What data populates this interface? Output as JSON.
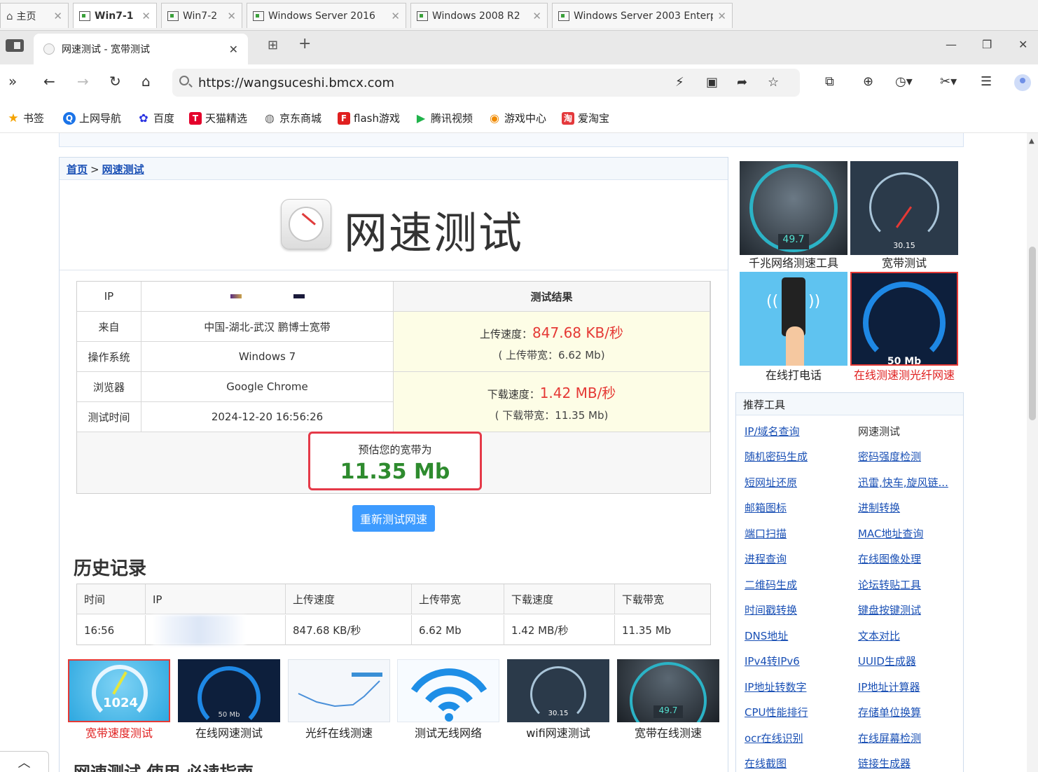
{
  "vm_tabs": [
    {
      "label": "主页",
      "active": false
    },
    {
      "label": "Win7-1",
      "active": true
    },
    {
      "label": "Win7-2",
      "active": false
    },
    {
      "label": "Windows Server 2016",
      "active": false
    },
    {
      "label": "Windows 2008 R2",
      "active": false
    },
    {
      "label": "Windows Server 2003 Enterpr...",
      "active": false
    }
  ],
  "browser": {
    "tab_title": "网速测试 - 宽带测试",
    "url": "https://wangsuceshi.bmcx.com"
  },
  "bookmarks": [
    {
      "label": "书签",
      "color": "#f5a300"
    },
    {
      "label": "上网导航",
      "color": "#1a73e8"
    },
    {
      "label": "百度",
      "color": "#2932e1"
    },
    {
      "label": "天猫精选",
      "color": "#e4002b"
    },
    {
      "label": "京东商城",
      "color": "#666666"
    },
    {
      "label": "flash游戏",
      "color": "#e02020"
    },
    {
      "label": "腾讯视频",
      "color": "#20b34b"
    },
    {
      "label": "游戏中心",
      "color": "#f08a00"
    },
    {
      "label": "爱淘宝",
      "color": "#e4393c"
    }
  ],
  "breadcrumb": {
    "home": "首页",
    "sep": ">",
    "current": "网速测试"
  },
  "hero_title": "网速测试",
  "result": {
    "ip_label": "IP",
    "from_label": "来自",
    "from_value": "中国-湖北-武汉 鹏博士宽带",
    "os_label": "操作系统",
    "os_value": "Windows 7",
    "browser_label": "浏览器",
    "browser_value": "Google Chrome",
    "time_label": "测试时间",
    "time_value": "2024-12-20 16:56:26",
    "result_header": "测试结果",
    "upload_label": "上传速度：",
    "upload_value": "847.68 KB/秒",
    "upload_bw": "( 上传带宽：6.62 Mb)",
    "download_label": "下载速度：",
    "download_value": "1.42 MB/秒",
    "download_bw": "( 下载带宽：11.35 Mb)",
    "estimate_label": "预估您的宽带为",
    "estimate_value": "11.35 Mb"
  },
  "retest_label": "重新测试网速",
  "history": {
    "title": "历史记录",
    "headers": [
      "时间",
      "IP",
      "上传速度",
      "上传带宽",
      "下载速度",
      "下载带宽"
    ],
    "row": [
      "16:56",
      "",
      "847.68 KB/秒",
      "6.62 Mb",
      "1.42 MB/秒",
      "11.35 Mb"
    ]
  },
  "thumbs": [
    {
      "caption": "宽带速度测试",
      "badge": "1024",
      "red": true
    },
    {
      "caption": "在线网速测试",
      "badge": "50 Mb"
    },
    {
      "caption": "光纤在线测速"
    },
    {
      "caption": "测试无线网络"
    },
    {
      "caption": "wifi网速测试",
      "badge": "30.15"
    },
    {
      "caption": "宽带在线测速",
      "badge": "49.7"
    }
  ],
  "guide_title": "网速测试 使用 必读指南",
  "side_images": [
    {
      "caption": "千兆网络测速工具",
      "badge": "49.7"
    },
    {
      "caption": "宽带测试",
      "badge": "30.15"
    },
    {
      "caption": "在线打电话"
    },
    {
      "caption": "在线测速测光纤网速",
      "badge": "50 Mb",
      "red": true
    }
  ],
  "tools": {
    "title": "推荐工具",
    "items": [
      {
        "label": "IP/域名查询",
        "link": true
      },
      {
        "label": "网速测试",
        "link": false
      },
      {
        "label": "随机密码生成",
        "link": true
      },
      {
        "label": "密码强度检测",
        "link": true
      },
      {
        "label": "短网址还原",
        "link": true
      },
      {
        "label": "迅雷,快车,旋风链...",
        "link": true
      },
      {
        "label": "邮箱图标",
        "link": true
      },
      {
        "label": "进制转换",
        "link": true
      },
      {
        "label": "端口扫描",
        "link": true
      },
      {
        "label": "MAC地址查询",
        "link": true
      },
      {
        "label": "进程查询",
        "link": true
      },
      {
        "label": "在线图像处理",
        "link": true
      },
      {
        "label": "二维码生成",
        "link": true
      },
      {
        "label": "论坛转贴工具",
        "link": true
      },
      {
        "label": "时间戳转换",
        "link": true
      },
      {
        "label": "键盘按键测试",
        "link": true
      },
      {
        "label": "DNS地址",
        "link": true
      },
      {
        "label": "文本对比",
        "link": true
      },
      {
        "label": "IPv4转IPv6",
        "link": true
      },
      {
        "label": "UUID生成器",
        "link": true
      },
      {
        "label": "IP地址转数字",
        "link": true
      },
      {
        "label": "IP地址计算器",
        "link": true
      },
      {
        "label": "CPU性能排行",
        "link": true
      },
      {
        "label": "存储单位换算",
        "link": true
      },
      {
        "label": "ocr在线识别",
        "link": true
      },
      {
        "label": "在线屏幕检测",
        "link": true
      },
      {
        "label": "在线截图",
        "link": true
      },
      {
        "label": "链接生成器",
        "link": true
      }
    ]
  }
}
